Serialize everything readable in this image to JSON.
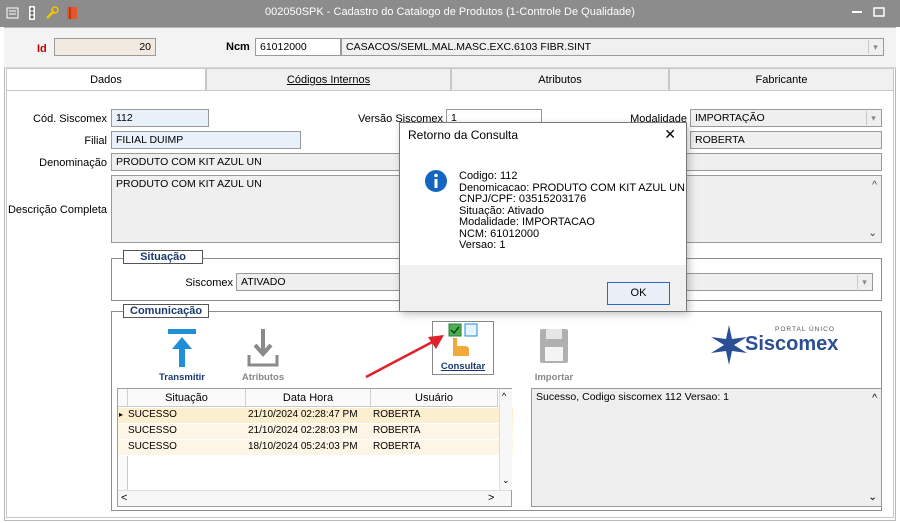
{
  "window": {
    "title": "002050SPK - Cadastro do Catalogo de Produtos (1-Controle De Qualidade)"
  },
  "header": {
    "id_label": "Id",
    "id_value": "20",
    "ncm_label": "Ncm",
    "ncm_code": "61012000",
    "ncm_desc": "CASACOS/SEML.MAL.MASC.EXC.6103 FIBR.SINT"
  },
  "tabs": [
    "Dados",
    "Códigos Internos",
    "Atributos",
    "Fabricante"
  ],
  "form": {
    "cod_siscomex_label": "Cód. Siscomex",
    "cod_siscomex": "112",
    "versao_label": "Versão Siscomex",
    "versao": "1",
    "modalidade_label": "Modalidade",
    "modalidade": "IMPORTAÇÃO",
    "filial_label": "Filial",
    "filial": "FILIAL DUIMP",
    "responsavel": "ROBERTA",
    "denominacao_label": "Denominação",
    "denominacao": "PRODUTO COM KIT AZUL UN",
    "descricao_label": "Descrição Completa",
    "descricao": "PRODUTO COM KIT AZUL UN"
  },
  "situacao": {
    "title": "Situação",
    "siscomex_label": "Siscomex",
    "siscomex_value": "ATIVADO"
  },
  "comunicacao": {
    "title": "Comunicação",
    "buttons": {
      "transmitir": "Transmitir",
      "atributos": "Atributos",
      "consultar": "Consultar",
      "importar": "Importar"
    },
    "logo_small": "PORTAL ÚNICO",
    "logo_main": "Siscomex",
    "grid_headers": [
      "Situação",
      "Data Hora",
      "Usuário"
    ],
    "rows": [
      {
        "situacao": "SUCESSO",
        "data": "21/10/2024 02:28:47 PM",
        "usuario": "ROBERTA"
      },
      {
        "situacao": "SUCESSO",
        "data": "21/10/2024 02:28:03 PM",
        "usuario": "ROBERTA"
      },
      {
        "situacao": "SUCESSO",
        "data": "18/10/2024 05:24:03 PM",
        "usuario": "ROBERTA"
      }
    ],
    "log_text": "Sucesso, Codigo siscomex 112 Versao: 1"
  },
  "dialog": {
    "title": "Retorno da Consulta",
    "lines": [
      "Codigo: 112",
      "Denomicacao: PRODUTO COM KIT AZUL UN",
      "CNPJ/CPF: 03515203176",
      "Situação: Ativado",
      "Modalidade: IMPORTACAO",
      "NCM: 61012000",
      "Versao: 1"
    ],
    "ok_label": "OK"
  },
  "colors": {
    "accent_blue": "#1e8fd8",
    "dialog_info": "#1565c0",
    "arrow_red": "#e0202a"
  }
}
